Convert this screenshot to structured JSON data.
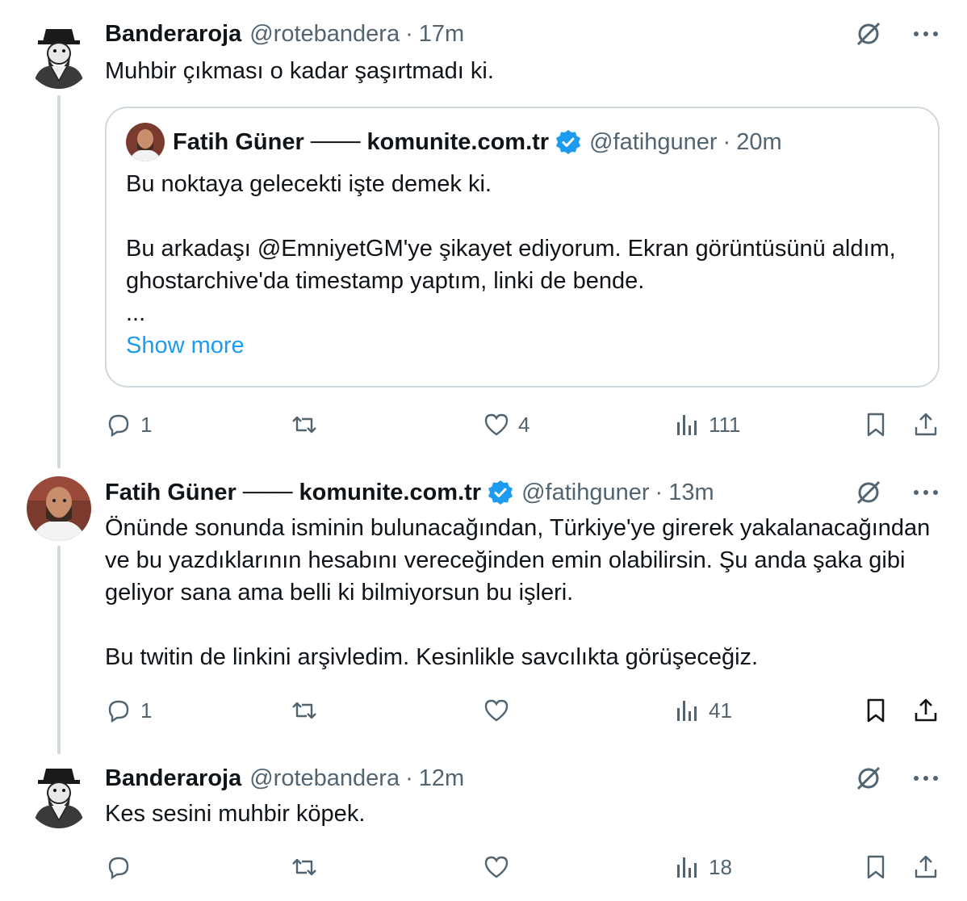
{
  "tweets": [
    {
      "name": "Banderaroja",
      "handle": "@rotebandera",
      "dot": "·",
      "time": "17m",
      "text": "Muhbir çıkması o kadar şaşırtmadı ki.",
      "quote": {
        "name": "Fatih Güner ─── komunite.com.tr",
        "handle": "@fatihguner",
        "dot": "·",
        "time": "20m",
        "text": "Bu noktaya gelecekti işte demek ki.\n\nBu arkadaşı @EmniyetGM'ye şikayet ediyorum. Ekran görüntüsünü aldım, ghostarchive'da timestamp yaptım, linki de bende.\n...",
        "show_more": "Show more"
      },
      "actions": {
        "replies": "1",
        "retweets": "",
        "likes": "4",
        "views": "111"
      }
    },
    {
      "name": "Fatih Güner ─── komunite.com.tr",
      "handle": "@fatihguner",
      "dot": "·",
      "time": "13m",
      "text": "Önünde sonunda isminin bulunacağından, Türkiye'ye girerek yakalanacağından ve bu yazdıklarının hesabını vereceğinden emin olabilirsin. Şu anda şaka gibi geliyor sana ama belli ki bilmiyorsun bu işleri.\n\nBu twitin de linkini arşivledim. Kesinlikle savcılıkta görüşeceğiz.",
      "actions": {
        "replies": "1",
        "retweets": "",
        "likes": "",
        "views": "41"
      }
    },
    {
      "name": "Banderaroja",
      "handle": "@rotebandera",
      "dot": "·",
      "time": "12m",
      "text": "Kes sesini muhbir köpek.",
      "actions": {
        "replies": "",
        "retweets": "",
        "likes": "",
        "views": "18"
      }
    }
  ],
  "colors": {
    "accent": "#1d9bf0",
    "secondary_text": "#536471",
    "border": "#cfd9de",
    "primary_text": "#0f1419"
  }
}
